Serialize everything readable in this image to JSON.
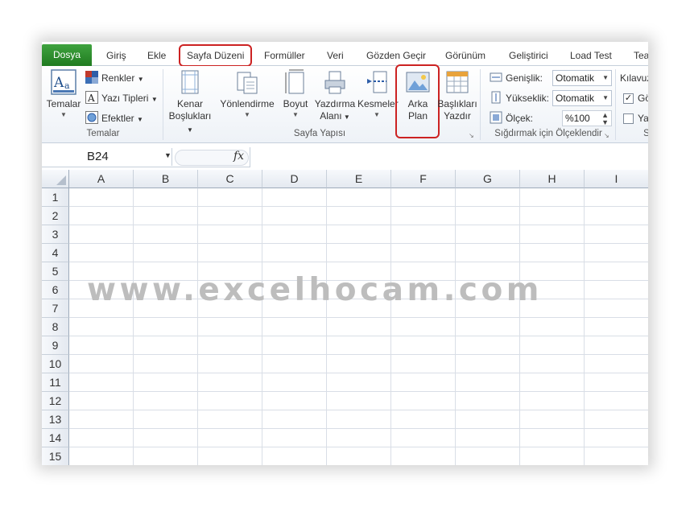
{
  "tabs": {
    "file": "Dosya",
    "home": "Giriş",
    "insert": "Ekle",
    "page_layout": "Sayfa Düzeni",
    "formulas": "Formüller",
    "data": "Veri",
    "review": "Gözden Geçir",
    "view": "Görünüm",
    "developer": "Geliştirici",
    "load_test": "Load Test",
    "team": "Tea"
  },
  "ribbon": {
    "themes_group": {
      "label": "Temalar",
      "themes_button": "Temalar",
      "colors": "Renkler",
      "fonts": "Yazı Tipleri",
      "effects": "Efektler"
    },
    "page_setup_group": {
      "label": "Sayfa Yapısı",
      "margins_line1": "Kenar",
      "margins_line2": "Boşlukları",
      "orientation": "Yönlendirme",
      "size": "Boyut",
      "print_area_line1": "Yazdırma",
      "print_area_line2": "Alanı",
      "breaks": "Kesmeler",
      "background_line1": "Arka",
      "background_line2": "Plan",
      "print_titles_line1": "Başlıkları",
      "print_titles_line2": "Yazdır"
    },
    "scale_group": {
      "label": "Sığdırmak için Ölçeklendir",
      "width_label": "Genişlik:",
      "width_value": "Otomatik",
      "height_label": "Yükseklik:",
      "height_value": "Otomatik",
      "scale_label": "Ölçek:",
      "scale_value": "%100"
    },
    "sheet_options_group": {
      "gridlines_label": "Kılavuz",
      "view_label": "Gö",
      "print_label": "Ya",
      "group_label_partial": "S"
    }
  },
  "formula_bar": {
    "name_box": "B24",
    "fx_label": "fx",
    "formula": ""
  },
  "grid": {
    "columns": [
      "A",
      "B",
      "C",
      "D",
      "E",
      "F",
      "G",
      "H",
      "I"
    ],
    "rows": [
      "1",
      "2",
      "3",
      "4",
      "5",
      "6",
      "7",
      "8",
      "9",
      "10",
      "11",
      "12",
      "13",
      "14",
      "15"
    ]
  },
  "watermark": "www.excelhocam.com",
  "colors": {
    "file_tab": "#2e8f2e",
    "highlight": "#cc2222",
    "watermark": "#bdbdbd"
  }
}
